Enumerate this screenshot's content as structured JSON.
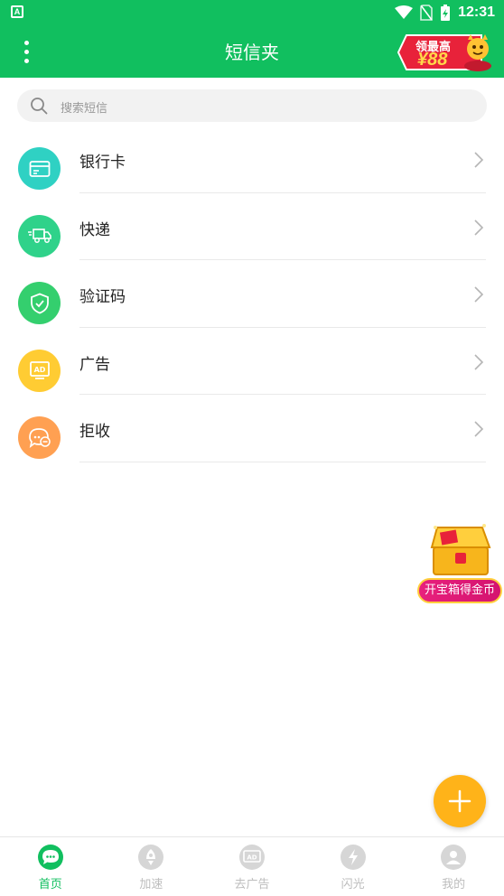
{
  "status_bar": {
    "time": "12:31",
    "app_icon": "A"
  },
  "app_bar": {
    "title": "短信夹",
    "promo_line1": "领最高",
    "promo_line2": "¥88"
  },
  "search": {
    "placeholder": "搜索短信"
  },
  "categories": [
    {
      "label": "银行卡",
      "icon": "bank-card-icon",
      "color": "#2fd1c3"
    },
    {
      "label": "快递",
      "icon": "delivery-truck-icon",
      "color": "#2fd28a"
    },
    {
      "label": "验证码",
      "icon": "shield-check-icon",
      "color": "#34cf6e"
    },
    {
      "label": "广告",
      "icon": "ad-icon",
      "color": "#ffcc33"
    },
    {
      "label": "拒收",
      "icon": "blocked-chat-icon",
      "color": "#ffa052"
    }
  ],
  "treasure": {
    "label": "开宝箱得金币"
  },
  "tabs": [
    {
      "label": "首页",
      "icon": "home-chat-icon",
      "active": true
    },
    {
      "label": "加速",
      "icon": "rocket-icon",
      "active": false
    },
    {
      "label": "去广告",
      "icon": "ad-icon",
      "active": false
    },
    {
      "label": "闪光",
      "icon": "flash-icon",
      "active": false
    },
    {
      "label": "我的",
      "icon": "profile-icon",
      "active": false
    }
  ],
  "colors": {
    "primary": "#11bf5f",
    "fab": "#ffb319"
  }
}
